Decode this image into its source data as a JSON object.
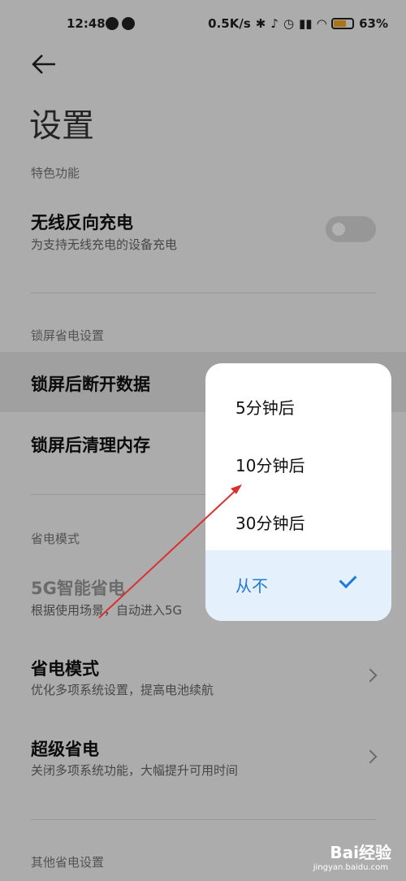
{
  "status": {
    "time": "12:48",
    "net_speed": "0.5K/s",
    "battery": "63"
  },
  "page": {
    "title": "设置"
  },
  "sections": {
    "features": "特色功能",
    "lock": "锁屏省电设置",
    "power": "省电模式",
    "other": "其他省电设置"
  },
  "rows": {
    "wireless": {
      "title": "无线反向充电",
      "subtitle": "为支持无线充电的设备充电"
    },
    "disconnect": {
      "title": "锁屏后断开数据"
    },
    "clean": {
      "title": "锁屏后清理内存"
    },
    "smart5g": {
      "title": "5G智能省电",
      "subtitle": "根据使用场景，自动进入5G"
    },
    "saver": {
      "title": "省电模式",
      "subtitle": "优化多项系统设置，提高电池续航"
    },
    "super": {
      "title": "超级省电",
      "subtitle": "关闭多项系统功能，大幅提升可用时间"
    }
  },
  "menu": {
    "options": [
      "5分钟后",
      "10分钟后",
      "30分钟后",
      "从不"
    ],
    "selected": "从不"
  },
  "watermark": {
    "logo": "Bai经验",
    "url": "jingyan.baidu.com"
  },
  "colors": {
    "accent": "#1f7ad6",
    "selected_bg": "#e4f0fc",
    "arrow": "#d93030"
  }
}
